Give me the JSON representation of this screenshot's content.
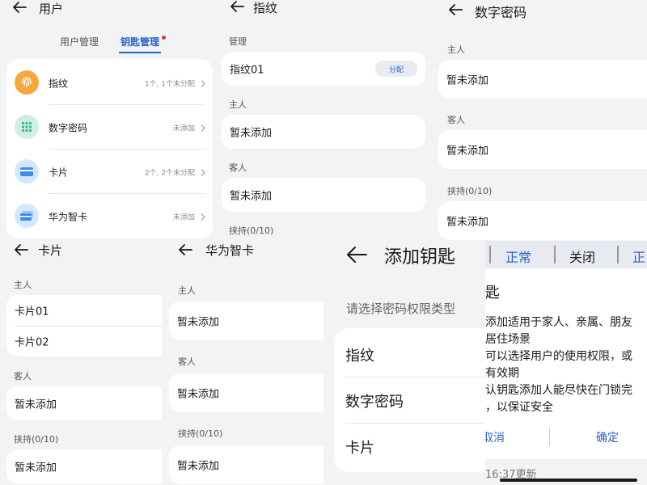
{
  "users_screen": {
    "title": "用户",
    "tabs": [
      {
        "label": "用户管理"
      },
      {
        "label": "钥匙管理"
      }
    ],
    "active_tab_color": "#2a61c9",
    "badge_color": "#e5352a",
    "items": [
      {
        "label": "指纹",
        "status": "1个, 1个未分配",
        "icon": "fingerprint-icon",
        "color": "#f5a93a"
      },
      {
        "label": "数字密码",
        "status": "未添加",
        "icon": "keypad-icon",
        "color": "#3fb89a"
      },
      {
        "label": "卡片",
        "status": "2个, 2个未分配",
        "icon": "card-icon",
        "color": "#3d8ee8"
      },
      {
        "label": "华为智卡",
        "status": "未添加",
        "icon": "smart-card-icon",
        "color": "#3d8ee8"
      }
    ]
  },
  "fingerprint_screen": {
    "title": "指纹",
    "sections": {
      "manage": "管理",
      "owner": "主人",
      "guest": "客人",
      "duress": "挟持(0/10)"
    },
    "entry": "指纹01",
    "assign_label": "分配",
    "empty_owner": "暂未添加",
    "empty_guest": "暂未添加"
  },
  "digital_pin_screen": {
    "title": "数字密码",
    "sections": {
      "owner": "主人",
      "guest": "客人",
      "duress": "挟持(0/10)"
    },
    "empty_owner": "暂未添加",
    "empty_guest": "暂未添加",
    "empty_duress": "暂未添加"
  },
  "card_screen": {
    "title": "卡片",
    "sections": {
      "owner": "主人",
      "guest": "客人",
      "duress": "挟持(0/10)"
    },
    "cards": [
      "卡片01",
      "卡片02"
    ],
    "empty_guest": "暂未添加",
    "empty_duress": "暂未添加"
  },
  "huawei_card_screen": {
    "title": "华为智卡",
    "sections": {
      "owner": "主人",
      "guest": "客人",
      "duress": "挟持(0/10)"
    },
    "empty_owner": "暂未添加",
    "empty_guest": "暂未添加",
    "empty_duress": "暂未添加"
  },
  "add_key_screen": {
    "title": "添加钥匙",
    "prompt": "请选择密码权限类型",
    "options": [
      "指纹",
      "数字密码",
      "卡片"
    ]
  },
  "dialog_screen": {
    "strip_labels": [
      "正常",
      "关闭",
      "正"
    ],
    "title": "匙",
    "lines": [
      "添加适用于家人、亲属、朋友",
      "居住场景",
      "可以选择用户的使用权限，或",
      "有效期",
      "认钥匙添加人能尽快在门锁完",
      "，以保证安全"
    ],
    "cancel_label": "取消",
    "confirm_label": "确定",
    "bottom_text": "16:37更新",
    "accent": "#2a61c9"
  }
}
